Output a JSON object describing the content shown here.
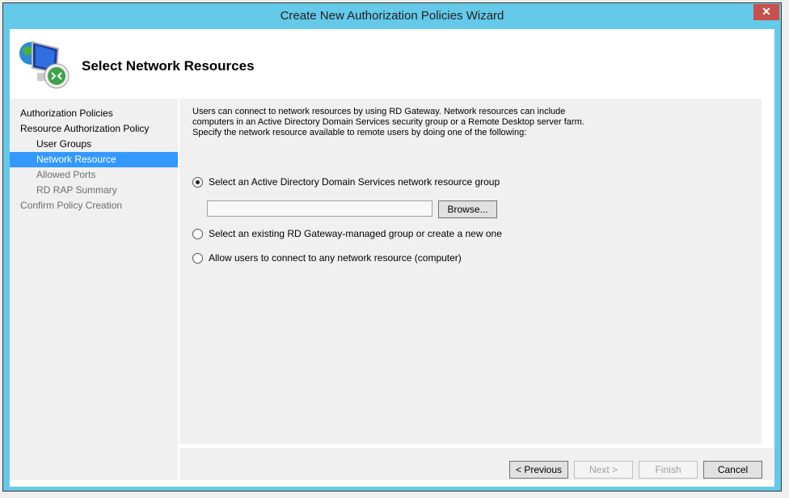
{
  "window": {
    "title": "Create New Authorization Policies Wizard",
    "close": "✕"
  },
  "header": {
    "title": "Select Network Resources"
  },
  "nav": [
    {
      "label": "Authorization Policies"
    },
    {
      "label": "Resource Authorization Policy"
    },
    {
      "label": "User Groups"
    },
    {
      "label": "Network Resource"
    },
    {
      "label": "Allowed Ports"
    },
    {
      "label": "RD RAP Summary"
    },
    {
      "label": "Confirm Policy Creation"
    }
  ],
  "main": {
    "description": [
      "Users can connect to network resources by using RD Gateway. Network resources can include",
      "computers in an Active Directory Domain Services security group or a Remote Desktop server farm.",
      "Specify the network resource available to remote users by doing one of the following:"
    ],
    "options": [
      {
        "label": "Select an Active Directory Domain Services network resource group",
        "selected": true
      },
      {
        "label": "Select an existing RD Gateway-managed group or create a new one",
        "selected": false
      },
      {
        "label": "Allow users to connect to any network resource (computer)",
        "selected": false
      }
    ],
    "group_value": "",
    "browse": "Browse..."
  },
  "buttons": {
    "previous": "< Previous",
    "next": "Next >",
    "finish": "Finish",
    "cancel": "Cancel"
  }
}
